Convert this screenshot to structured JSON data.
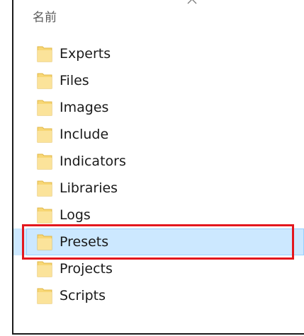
{
  "colors": {
    "selection_bg": "#cce8ff",
    "selection_border": "#99d1ff",
    "highlight": "#e3171d",
    "folder": "#f8d775"
  },
  "header": {
    "label": "名前",
    "sort_icon": "chevron-up-icon"
  },
  "folders": [
    {
      "label": "Experts",
      "selected": false
    },
    {
      "label": "Files",
      "selected": false
    },
    {
      "label": "Images",
      "selected": false
    },
    {
      "label": "Include",
      "selected": false
    },
    {
      "label": "Indicators",
      "selected": false
    },
    {
      "label": "Libraries",
      "selected": false
    },
    {
      "label": "Logs",
      "selected": false
    },
    {
      "label": "Presets",
      "selected": true
    },
    {
      "label": "Projects",
      "selected": false
    },
    {
      "label": "Scripts",
      "selected": false
    }
  ]
}
